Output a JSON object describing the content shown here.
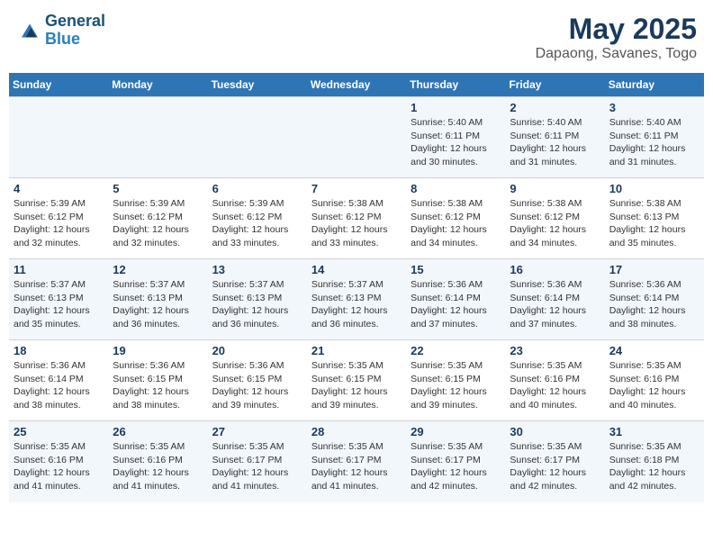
{
  "header": {
    "logo_line1": "General",
    "logo_line2": "Blue",
    "title": "May 2025",
    "subtitle": "Dapaong, Savanes, Togo"
  },
  "weekdays": [
    "Sunday",
    "Monday",
    "Tuesday",
    "Wednesday",
    "Thursday",
    "Friday",
    "Saturday"
  ],
  "weeks": [
    [
      {
        "day": "",
        "info": ""
      },
      {
        "day": "",
        "info": ""
      },
      {
        "day": "",
        "info": ""
      },
      {
        "day": "",
        "info": ""
      },
      {
        "day": "1",
        "info": "Sunrise: 5:40 AM\nSunset: 6:11 PM\nDaylight: 12 hours\nand 30 minutes."
      },
      {
        "day": "2",
        "info": "Sunrise: 5:40 AM\nSunset: 6:11 PM\nDaylight: 12 hours\nand 31 minutes."
      },
      {
        "day": "3",
        "info": "Sunrise: 5:40 AM\nSunset: 6:11 PM\nDaylight: 12 hours\nand 31 minutes."
      }
    ],
    [
      {
        "day": "4",
        "info": "Sunrise: 5:39 AM\nSunset: 6:12 PM\nDaylight: 12 hours\nand 32 minutes."
      },
      {
        "day": "5",
        "info": "Sunrise: 5:39 AM\nSunset: 6:12 PM\nDaylight: 12 hours\nand 32 minutes."
      },
      {
        "day": "6",
        "info": "Sunrise: 5:39 AM\nSunset: 6:12 PM\nDaylight: 12 hours\nand 33 minutes."
      },
      {
        "day": "7",
        "info": "Sunrise: 5:38 AM\nSunset: 6:12 PM\nDaylight: 12 hours\nand 33 minutes."
      },
      {
        "day": "8",
        "info": "Sunrise: 5:38 AM\nSunset: 6:12 PM\nDaylight: 12 hours\nand 34 minutes."
      },
      {
        "day": "9",
        "info": "Sunrise: 5:38 AM\nSunset: 6:12 PM\nDaylight: 12 hours\nand 34 minutes."
      },
      {
        "day": "10",
        "info": "Sunrise: 5:38 AM\nSunset: 6:13 PM\nDaylight: 12 hours\nand 35 minutes."
      }
    ],
    [
      {
        "day": "11",
        "info": "Sunrise: 5:37 AM\nSunset: 6:13 PM\nDaylight: 12 hours\nand 35 minutes."
      },
      {
        "day": "12",
        "info": "Sunrise: 5:37 AM\nSunset: 6:13 PM\nDaylight: 12 hours\nand 36 minutes."
      },
      {
        "day": "13",
        "info": "Sunrise: 5:37 AM\nSunset: 6:13 PM\nDaylight: 12 hours\nand 36 minutes."
      },
      {
        "day": "14",
        "info": "Sunrise: 5:37 AM\nSunset: 6:13 PM\nDaylight: 12 hours\nand 36 minutes."
      },
      {
        "day": "15",
        "info": "Sunrise: 5:36 AM\nSunset: 6:14 PM\nDaylight: 12 hours\nand 37 minutes."
      },
      {
        "day": "16",
        "info": "Sunrise: 5:36 AM\nSunset: 6:14 PM\nDaylight: 12 hours\nand 37 minutes."
      },
      {
        "day": "17",
        "info": "Sunrise: 5:36 AM\nSunset: 6:14 PM\nDaylight: 12 hours\nand 38 minutes."
      }
    ],
    [
      {
        "day": "18",
        "info": "Sunrise: 5:36 AM\nSunset: 6:14 PM\nDaylight: 12 hours\nand 38 minutes."
      },
      {
        "day": "19",
        "info": "Sunrise: 5:36 AM\nSunset: 6:15 PM\nDaylight: 12 hours\nand 38 minutes."
      },
      {
        "day": "20",
        "info": "Sunrise: 5:36 AM\nSunset: 6:15 PM\nDaylight: 12 hours\nand 39 minutes."
      },
      {
        "day": "21",
        "info": "Sunrise: 5:35 AM\nSunset: 6:15 PM\nDaylight: 12 hours\nand 39 minutes."
      },
      {
        "day": "22",
        "info": "Sunrise: 5:35 AM\nSunset: 6:15 PM\nDaylight: 12 hours\nand 39 minutes."
      },
      {
        "day": "23",
        "info": "Sunrise: 5:35 AM\nSunset: 6:16 PM\nDaylight: 12 hours\nand 40 minutes."
      },
      {
        "day": "24",
        "info": "Sunrise: 5:35 AM\nSunset: 6:16 PM\nDaylight: 12 hours\nand 40 minutes."
      }
    ],
    [
      {
        "day": "25",
        "info": "Sunrise: 5:35 AM\nSunset: 6:16 PM\nDaylight: 12 hours\nand 41 minutes."
      },
      {
        "day": "26",
        "info": "Sunrise: 5:35 AM\nSunset: 6:16 PM\nDaylight: 12 hours\nand 41 minutes."
      },
      {
        "day": "27",
        "info": "Sunrise: 5:35 AM\nSunset: 6:17 PM\nDaylight: 12 hours\nand 41 minutes."
      },
      {
        "day": "28",
        "info": "Sunrise: 5:35 AM\nSunset: 6:17 PM\nDaylight: 12 hours\nand 41 minutes."
      },
      {
        "day": "29",
        "info": "Sunrise: 5:35 AM\nSunset: 6:17 PM\nDaylight: 12 hours\nand 42 minutes."
      },
      {
        "day": "30",
        "info": "Sunrise: 5:35 AM\nSunset: 6:17 PM\nDaylight: 12 hours\nand 42 minutes."
      },
      {
        "day": "31",
        "info": "Sunrise: 5:35 AM\nSunset: 6:18 PM\nDaylight: 12 hours\nand 42 minutes."
      }
    ]
  ]
}
